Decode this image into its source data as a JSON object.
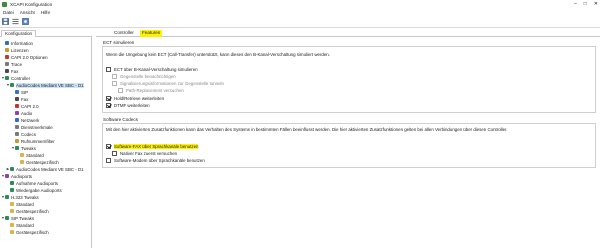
{
  "window": {
    "title": "XCAPI Konfiguration"
  },
  "menu": [
    "Datei",
    "Ansicht",
    "Hilfe"
  ],
  "left_tab": "Konfiguration",
  "tree": [
    {
      "label": "Information",
      "icon": "info-icon",
      "color": "#2f6fc0",
      "level": 1,
      "toggle": ""
    },
    {
      "label": "Lizenzen",
      "icon": "key-icon",
      "color": "#c99a2e",
      "level": 1,
      "toggle": ""
    },
    {
      "label": "CAPI 2.0 Optionen",
      "icon": "capi-icon",
      "color": "#c0392b",
      "level": 1,
      "toggle": ""
    },
    {
      "label": "Trace",
      "icon": "trace-icon",
      "color": "#7a7a7a",
      "level": 1,
      "toggle": ""
    },
    {
      "label": "Fax",
      "icon": "fax-icon",
      "color": "#4a4a4a",
      "level": 1,
      "toggle": ""
    },
    {
      "label": "Controller",
      "icon": "controller-icon",
      "color": "#2e8b57",
      "level": 1,
      "toggle": "▼"
    },
    {
      "label": "AudioCodes Mediant VE SBC - D1",
      "icon": "device-icon",
      "color": "#2e8b57",
      "level": 2,
      "toggle": "▼",
      "selected": true
    },
    {
      "label": "SIP",
      "icon": "sip-icon",
      "color": "#3a6fc4",
      "level": 3,
      "toggle": ""
    },
    {
      "label": "Fax",
      "icon": "fax-icon",
      "color": "#4a4a4a",
      "level": 3,
      "toggle": ""
    },
    {
      "label": "CAPI 2.0",
      "icon": "capi-icon",
      "color": "#c0392b",
      "level": 3,
      "toggle": ""
    },
    {
      "label": "Audio",
      "icon": "audio-icon",
      "color": "#8e44ad",
      "level": 3,
      "toggle": ""
    },
    {
      "label": "Netzwerk",
      "icon": "network-icon",
      "color": "#2f6fc0",
      "level": 3,
      "toggle": ""
    },
    {
      "label": "Dienstmerkmale",
      "icon": "feature-icon",
      "color": "#7a7a7a",
      "level": 3,
      "toggle": ""
    },
    {
      "label": "Codecs",
      "icon": "codec-icon",
      "color": "#7a7a7a",
      "level": 3,
      "toggle": ""
    },
    {
      "label": "Rufnummernfilter",
      "icon": "filter-icon",
      "color": "#c99a2e",
      "level": 3,
      "toggle": ""
    },
    {
      "label": "Tweaks",
      "icon": "tweak-icon",
      "color": "#2e8b57",
      "level": 3,
      "toggle": "▼"
    },
    {
      "label": "Standard",
      "icon": "folder-icon",
      "color": "#d9b44a",
      "level": 4,
      "toggle": ""
    },
    {
      "label": "Gerätespezifisch",
      "icon": "folder-icon",
      "color": "#d9b44a",
      "level": 4,
      "toggle": ""
    },
    {
      "label": "AudioCodes Mediant VE SBC - D1",
      "icon": "device-icon",
      "color": "#2e8b57",
      "level": 2,
      "toggle": "▶"
    },
    {
      "label": "Audioports",
      "icon": "audio-icon",
      "color": "#8e44ad",
      "level": 1,
      "toggle": "▼"
    },
    {
      "label": "Aufnahme Audioports",
      "icon": "record-icon",
      "color": "#2e8b57",
      "level": 2,
      "toggle": ""
    },
    {
      "label": "Wiedergabe Audioports",
      "icon": "play-icon",
      "color": "#2e8b57",
      "level": 2,
      "toggle": ""
    },
    {
      "label": "H.323 Tweaks",
      "icon": "tweak-icon",
      "color": "#2e8b57",
      "level": 1,
      "toggle": "▼"
    },
    {
      "label": "Standard",
      "icon": "folder-icon",
      "color": "#d9b44a",
      "level": 2,
      "toggle": ""
    },
    {
      "label": "Gerätespezifisch",
      "icon": "folder-icon",
      "color": "#d9b44a",
      "level": 2,
      "toggle": ""
    },
    {
      "label": "SIP Tweaks",
      "icon": "tweak-icon",
      "color": "#2e8b57",
      "level": 1,
      "toggle": "▼"
    },
    {
      "label": "Standard",
      "icon": "folder-icon",
      "color": "#d9b44a",
      "level": 2,
      "toggle": ""
    },
    {
      "label": "Gerätespezifisch",
      "icon": "folder-icon",
      "color": "#d9b44a",
      "level": 2,
      "toggle": ""
    }
  ],
  "right_tabs": {
    "controller": "Controller",
    "features": "Features"
  },
  "ect": {
    "title": "ECT simulieren",
    "description": "Wenn die Umgebung kein ECT (Call-Transfer) unterstützt, kann dieses den B-Kanal-Verschaltung simuliert werden.",
    "options": [
      {
        "label": "ECT über B-Kanal-Verschaltung simulieren",
        "checked": false,
        "disabled": false
      },
      {
        "label": "Gegenstelle benachrichtigen",
        "checked": false,
        "disabled": true
      },
      {
        "label": "Signalisierungsinformationen zur Gegenstelle tunneln",
        "checked": false,
        "disabled": true
      },
      {
        "label": "Path-Replacement versuchen",
        "checked": false,
        "disabled": true
      },
      {
        "label": "Hold/Retrieve weiterleiten",
        "checked": true,
        "disabled": false
      },
      {
        "label": "DTMF weiterleiten",
        "checked": true,
        "disabled": false
      }
    ]
  },
  "codecs": {
    "title": "Software Codecs",
    "description": "Mit den hier aktivierten Zusatzfunktionen kann das Verhalten des Systems in bestimmten Fällen beeinflusst werden. Die hier aktivierten Zusatzfunktionen gelten bei allen Verbindungen über diesen Controller.",
    "options": [
      {
        "label": "Software-FAX über Sprachkanäle benutzen",
        "checked": true,
        "disabled": false,
        "highlight": true
      },
      {
        "label": "Nativer Fax zuerst versuchen",
        "checked": false,
        "disabled": false
      },
      {
        "label": "Software-Modem über Sprachkanäle benutzen",
        "checked": false,
        "disabled": false
      }
    ]
  }
}
